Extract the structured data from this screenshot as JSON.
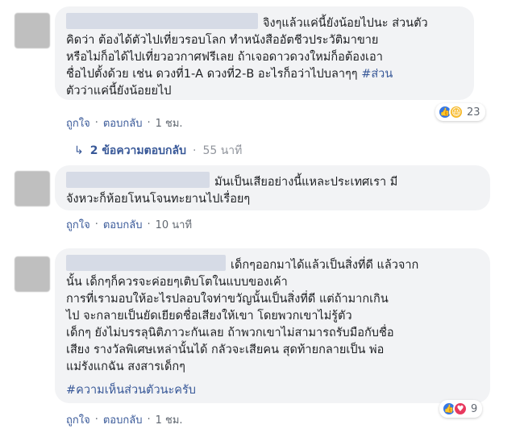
{
  "comments": [
    {
      "lines": [
        "จิงๆแล้วแค่นี้ยังน้อยไปนะ ส่วนตัว",
        "คิดว่า ต้องได้ตัวไปเที่ยวรอบโลก ทำหนังสืออัตชีวประวัติมาขาย",
        "หรือไม่ก็อได้ไปเที่ยวอวกาศฟรีเลย ถ้าเจอดาวดวงใหม่ก็อต้องเอา",
        "ชื่อไปตั้งด้วย เช่น ดวงที่1-A ดวงที่2-B อะไรก็อว่าไปบลาๆๆ ",
        "ตัวว่าแค่นี้ยังน้อยยไป"
      ],
      "hashtag_inline": "#ส่วน",
      "like_label": "ถูกใจ",
      "reply_label": "ตอบกลับ",
      "time": "1 ชม.",
      "reaction_count": "23",
      "reply_thread": {
        "label": "2 ข้อความตอบกลับ",
        "time": "55 นาที"
      }
    },
    {
      "lines": [
        "มันเป็นเสียอย่างนี้แหละประเทศเรา มี",
        "จังหวะก็ห้อยโหนโจนทะยานไปเรื่อยๆ"
      ],
      "like_label": "ถูกใจ",
      "reply_label": "ตอบกลับ",
      "time": "10 นาที"
    },
    {
      "lines": [
        "เด็กๆออกมาได้แล้วเป็นสิ่งที่ดี แล้วจาก",
        "นั้น เด็กๆก็ควรจะค่อยๆเติบโตในแบบของเค้า",
        "การที่เรามอบให้อะไรปลอบใจท่าขวัญนั้นเป็นสิ่งที่ดี แต่ถ้ามากเกิน",
        "ไป จะกลายเป็นยัดเยียดชื่อเสียงให้เขา โดยพวกเขาไม่รู้ตัว",
        "เด็กๆ ยังไม่บรรลุนิติภาวะกันเลย ถ้าพวกเขาไม่สามารถรับมือกับชื่อ",
        "เสียง รางวัลพิเศษเหล่านั้นได้ กลัวจะเสียคน สุดท้ายกลายเป็น พ่อ",
        "แม่รังแกฉัน สงสารเด็กๆ"
      ],
      "hashtag": "#ความเห็นส่วนตัวนะครับ",
      "like_label": "ถูกใจ",
      "reply_label": "ตอบกลับ",
      "time": "1 ชม.",
      "reaction_count": "9"
    }
  ],
  "separator": "·",
  "icons": {
    "like": "like-icon",
    "haha": "haha-icon",
    "love": "love-icon",
    "reply_arrow": "reply-arrow-icon"
  },
  "colors": {
    "link": "#385898",
    "bubble": "#f2f3f5",
    "like": "#3578e5",
    "haha": "#f7b928",
    "love": "#e8395e"
  }
}
